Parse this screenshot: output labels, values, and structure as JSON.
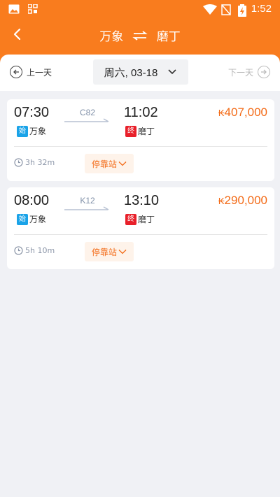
{
  "status_bar": {
    "time": "1:52"
  },
  "nav": {
    "from": "万象",
    "to": "磨丁"
  },
  "date_bar": {
    "prev_label": "上一天",
    "date_label": "周六, 03-18",
    "next_label": "下一天"
  },
  "colors": {
    "header": "#f97c1e",
    "price": "#f36a16",
    "start_badge": "#1aa3e8",
    "end_badge": "#e8202a"
  },
  "trips": [
    {
      "depart_time": "07:30",
      "arrive_time": "11:02",
      "train_no": "C82",
      "currency": "₭",
      "price": "407,000",
      "start_badge": "始",
      "from_station": "万象",
      "end_badge": "终",
      "to_station": "磨丁",
      "duration": "3h 32m",
      "stops_label": "停靠站"
    },
    {
      "depart_time": "08:00",
      "arrive_time": "13:10",
      "train_no": "K12",
      "currency": "₭",
      "price": "290,000",
      "start_badge": "始",
      "from_station": "万象",
      "end_badge": "终",
      "to_station": "磨丁",
      "duration": "5h 10m",
      "stops_label": "停靠站"
    }
  ]
}
